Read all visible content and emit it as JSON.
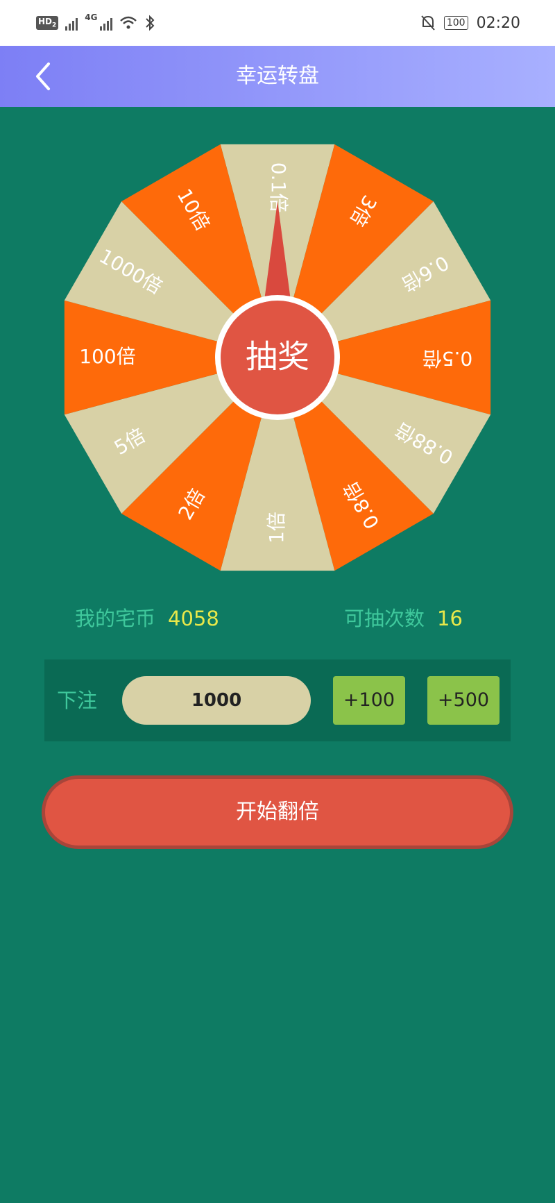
{
  "status_bar": {
    "hd": "HD",
    "hd_sub": "2",
    "network": "4G",
    "battery": "100",
    "time": "02:20"
  },
  "app_bar": {
    "title": "幸运转盘"
  },
  "wheel": {
    "center_label": "抽奖",
    "segments": [
      "0.1倍",
      "3倍",
      "0.6倍",
      "0.5倍",
      "0.88倍",
      "0.8倍",
      "1倍",
      "2倍",
      "5倍",
      "100倍",
      "1000倍",
      "10倍"
    ],
    "colors": {
      "orange": "#fe6a0a",
      "beige": "#d8d1a6",
      "center": "#e05543",
      "pointer": "#d9493e"
    }
  },
  "stats": {
    "coins_label": "我的宅币",
    "coins_value": "4058",
    "draws_label": "可抽次数",
    "draws_value": "16"
  },
  "bet": {
    "label": "下注",
    "value": "1000",
    "plus100_label": "+100",
    "plus500_label": "+500"
  },
  "start_button": {
    "label": "开始翻倍"
  },
  "colors": {
    "background": "#0e7b63",
    "accent_green": "#8bc34a",
    "start_red": "#e05543"
  }
}
